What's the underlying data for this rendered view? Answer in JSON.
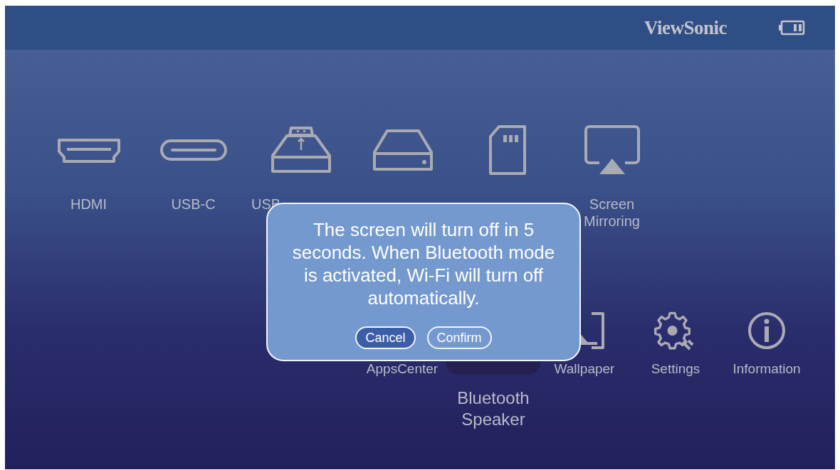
{
  "header": {
    "logo": "ViewSonic"
  },
  "sources": [
    {
      "label": "HDMI",
      "kind": "hdmi"
    },
    {
      "label": "USB-C",
      "kind": "usbc"
    },
    {
      "label": "USB",
      "kind": "usbreader"
    },
    {
      "kind": "storage"
    },
    {
      "kind": "sd"
    },
    {
      "label": "Screen Mirroring",
      "kind": "mirror"
    }
  ],
  "apps": [
    {
      "label": "AppsCenter",
      "kind": "apps",
      "selected": false
    },
    {
      "label": "Bluetooth Speaker",
      "kind": "bluetooth",
      "selected": true
    },
    {
      "label": "Wallpaper",
      "kind": "wallpaper",
      "selected": false
    },
    {
      "label": "Settings",
      "kind": "settings",
      "selected": false
    },
    {
      "label": "Information",
      "kind": "info",
      "selected": false
    }
  ],
  "dialog": {
    "message": "The screen will turn off in 5 seconds. When Bluetooth mode is activated, Wi-Fi will turn off automatically.",
    "buttons": [
      {
        "label": "Cancel",
        "selected": true
      },
      {
        "label": "Confirm",
        "selected": false
      }
    ]
  }
}
